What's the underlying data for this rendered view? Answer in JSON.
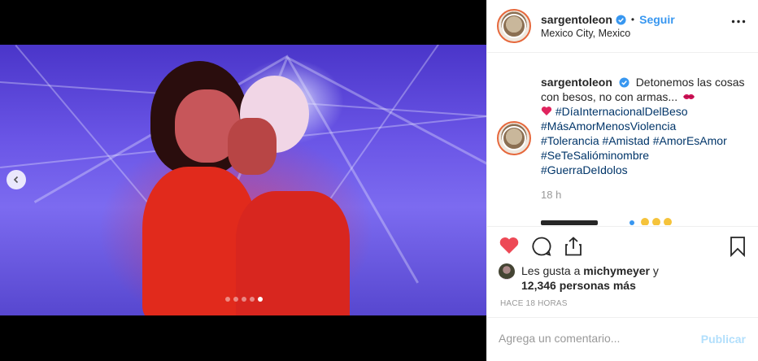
{
  "post": {
    "username": "sargentoleon",
    "follow_label": "Seguir",
    "separator": "•",
    "location": "Mexico City, Mexico",
    "caption_text": "Detonemos las cosas con besos, no con armas...",
    "hashtags_inline": "#DíaInternacionalDelBeso",
    "hashtags": [
      "#MásAmorMenosViolencia",
      "#Tolerancia #Amistad #AmorEsAmor",
      "#SeTeSalióminombre",
      "#GuerraDeIdolos"
    ],
    "time": "18 h",
    "likes": {
      "prefix": "Les gusta a",
      "user": "michymeyer",
      "conj": "y",
      "count_text": "12,346 personas más"
    },
    "ago": "HACE 18 HORAS",
    "comment_placeholder": "Agrega un comentario...",
    "post_label": "Publicar",
    "carousel": {
      "total": 5,
      "active_index": 4
    }
  },
  "colors": {
    "accent": "#3897f0",
    "like_red": "#ed4956",
    "hashtag": "#003569",
    "post_disabled": "#b2dffc"
  },
  "icons": [
    "more-icon",
    "verified-icon",
    "heart-icon",
    "comment-icon",
    "share-icon",
    "bookmark-icon",
    "chevron-left-icon"
  ]
}
